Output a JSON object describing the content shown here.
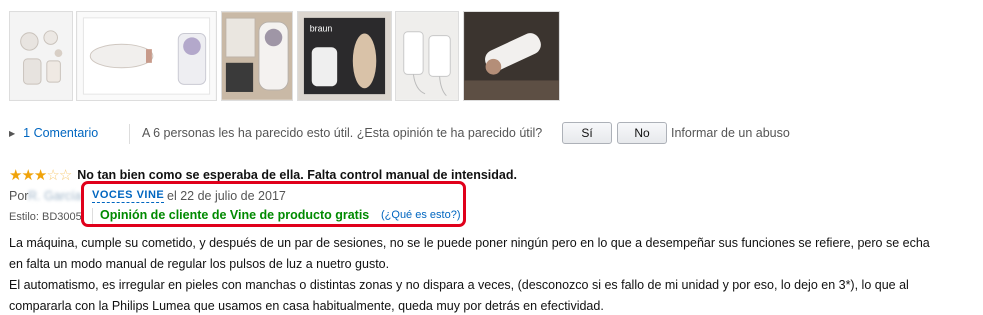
{
  "thumbnails": [
    {
      "name": "thumb-accessories",
      "icon": "epilator-accessories-image"
    },
    {
      "name": "thumb-device-box",
      "icon": "epilator-device-image"
    },
    {
      "name": "thumb-unboxed",
      "icon": "unboxed-device-image"
    },
    {
      "name": "thumb-box-front",
      "icon": "braun-box-image"
    },
    {
      "name": "thumb-chargers",
      "icon": "chargers-image"
    },
    {
      "name": "thumb-device-hand",
      "icon": "device-in-hand-image"
    }
  ],
  "actions": {
    "comments_label": "1 Comentario",
    "helpful_text": "A 6 personas les ha parecido esto útil. ¿Esta opinión te ha parecido útil?",
    "yes_label": "Sí",
    "no_label": "No",
    "report_label": "Informar de un abuso"
  },
  "review": {
    "rating": 3,
    "rating_max": 5,
    "title": "No tan bien como se esperaba de ella. Falta control manual de intensidad.",
    "by_label": "Por",
    "author": "R. García",
    "badge": "VOCES VINE",
    "date": "el 22 de julio de 2017",
    "style": "Estilo: BD3005",
    "vine_label": "Opinión de cliente de Vine de producto gratis",
    "vine_help": "(¿Qué es esto?)",
    "body": [
      "La máquina, cumple su cometido, y después de un par de sesiones, no se le puede poner ningún pero en lo que a desempeñar sus funciones se refiere, pero se echa",
      "en falta un modo manual de regular los pulsos de luz a nuetro gusto.",
      "El automatismo, es irregular en pieles con manchas o distintas zonas y no dispara a veces, (desconozco si es fallo de mi unidad y por eso, lo dejo en 3*), lo que al",
      "compararla con la Philips Lumea que usamos en casa habitualmente, queda muy por detrás en efectividad."
    ]
  },
  "colors": {
    "link": "#0066c0",
    "star": "#f0a30a",
    "vine_green": "#008a00",
    "highlight": "#e0001b"
  }
}
